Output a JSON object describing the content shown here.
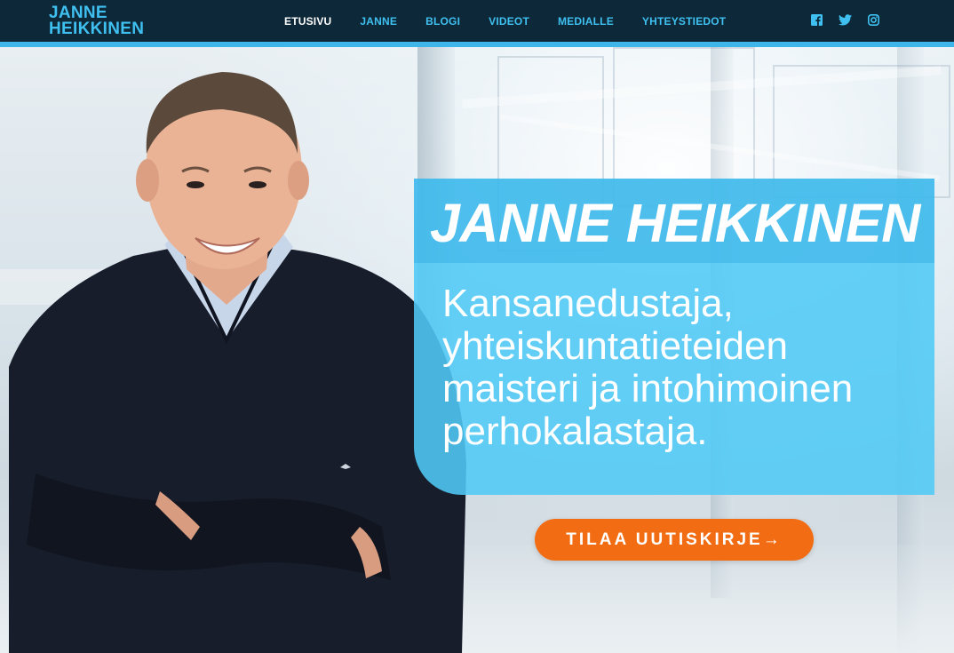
{
  "header": {
    "logo_line1": "JANNE",
    "logo_line2": "HEIKKINEN",
    "nav": [
      {
        "label": "ETUSIVU",
        "active": true
      },
      {
        "label": "JANNE"
      },
      {
        "label": "BLOGI"
      },
      {
        "label": "VIDEOT"
      },
      {
        "label": "MEDIALLE"
      },
      {
        "label": "YHTEYSTIEDOT"
      }
    ],
    "social_icons": [
      "facebook-icon",
      "twitter-icon",
      "instagram-icon"
    ]
  },
  "hero": {
    "title": "JANNE HEIKKINEN",
    "subtitle": "Kansanedustaja, yhteiskuntatieteiden maisteri ja intohimoinen perhokalastaja.",
    "cta_label": "TILAA UUTISKIRJE",
    "cta_arrow": "→"
  },
  "colors": {
    "header_bg": "#0d2838",
    "accent": "#3fc0f0",
    "cta": "#f26c13"
  }
}
